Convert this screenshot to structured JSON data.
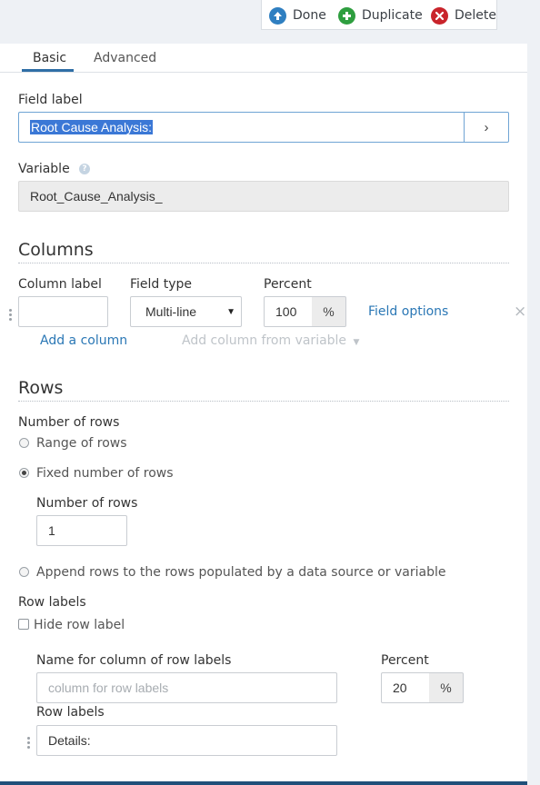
{
  "toolbar": {
    "done": "Done",
    "duplicate": "Duplicate",
    "delete": "Delete",
    "done_color": "#2f7fc1",
    "duplicate_color": "#2e9e3f",
    "delete_color": "#c9242b"
  },
  "tabs": [
    {
      "label": "Basic",
      "active": true
    },
    {
      "label": "Advanced",
      "active": false
    }
  ],
  "field_label": {
    "label": "Field label",
    "value": "Root Cause Analysis:",
    "button": "›"
  },
  "variable": {
    "label": "Variable",
    "help_icon": "?",
    "value": "Root_Cause_Analysis_"
  },
  "columns": {
    "title": "Columns",
    "column_label_header": "Column label",
    "field_type_header": "Field type",
    "percent_header": "Percent",
    "column_label_value": "",
    "field_type_value": "Multi-line",
    "percent_value": "100",
    "percent_unit": "%",
    "field_options": "Field options",
    "remove_icon": "×",
    "add_column": "Add a column",
    "add_from_variable": "Add column from variable"
  },
  "rows": {
    "title": "Rows",
    "number_of_rows_label": "Number of rows",
    "option_range": "Range of rows",
    "option_fixed": "Fixed number of rows",
    "selected_option": "Fixed number of rows",
    "fixed_count_label": "Number of rows",
    "fixed_count_value": "1",
    "option_append": "Append rows to the rows populated by a data source or variable",
    "row_labels_title": "Row labels",
    "hide_row_label": "Hide row label",
    "name_col_label": "Name for column of row labels",
    "name_col_placeholder": "column for row labels",
    "percent_label": "Percent",
    "percent_value": "20",
    "percent_unit": "%",
    "row_labels_label": "Row labels",
    "row_label_value": "Details:"
  }
}
